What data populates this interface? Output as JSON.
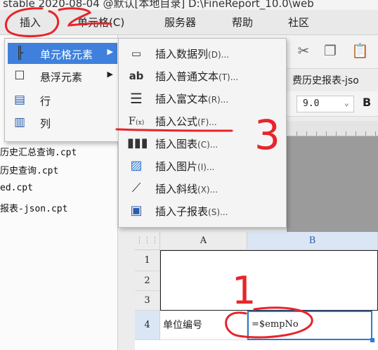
{
  "window": {
    "title_fragment": "stable 2020-08-04 @默认[本地目录]   D:\\FineReport_10.0\\web"
  },
  "menubar": {
    "items": [
      "插入",
      "单元格(C)",
      "服务器",
      "帮助",
      "社区"
    ]
  },
  "insert_menu": {
    "items": [
      {
        "icon": "grid-cursor-icon",
        "label": "单元格元素",
        "has_submenu": true,
        "highlighted": true
      },
      {
        "icon": "float-box-icon",
        "label": "悬浮元素",
        "has_submenu": true,
        "highlighted": false
      },
      {
        "icon": "row-icon",
        "label": "行",
        "has_submenu": false,
        "highlighted": false
      },
      {
        "icon": "column-icon",
        "label": "列",
        "has_submenu": false,
        "highlighted": false
      }
    ]
  },
  "cell_element_submenu": {
    "items": [
      {
        "icon": "data-column-icon",
        "label": "插入数据列",
        "key": "(D)..."
      },
      {
        "icon": "plain-text-icon",
        "label": "插入普通文本",
        "key": "(T)..."
      },
      {
        "icon": "rich-text-icon",
        "label": "插入富文本",
        "key": "(R)..."
      },
      {
        "icon": "formula-icon",
        "label": "插入公式",
        "key": "(F)..."
      },
      {
        "icon": "chart-icon",
        "label": "插入图表",
        "key": "(C)..."
      },
      {
        "icon": "picture-icon",
        "label": "插入图片",
        "key": "(I)..."
      },
      {
        "icon": "slash-line-icon",
        "label": "插入斜线",
        "key": "(X)..."
      },
      {
        "icon": "sub-report-icon",
        "label": "插入子报表",
        "key": "(S)..."
      }
    ]
  },
  "toolbar": {
    "tab_fragment": "费历史报表-jso",
    "font_size": "9.0",
    "bold_label": "B"
  },
  "files": [
    "历史汇总查询.cpt",
    "历史查询.cpt",
    "ed.cpt",
    "报表-json.cpt"
  ],
  "grid": {
    "columns": [
      "A",
      "B"
    ],
    "rows": [
      "1",
      "2",
      "3",
      "4"
    ],
    "cell_a4": "单位编号",
    "cell_b4": "=$empNo"
  },
  "annotations": {
    "step_1": "1",
    "step_3": "3"
  },
  "colors": {
    "highlight": "#3f80dd",
    "selection": "#2f78d6",
    "annotation": "#e8242a"
  }
}
